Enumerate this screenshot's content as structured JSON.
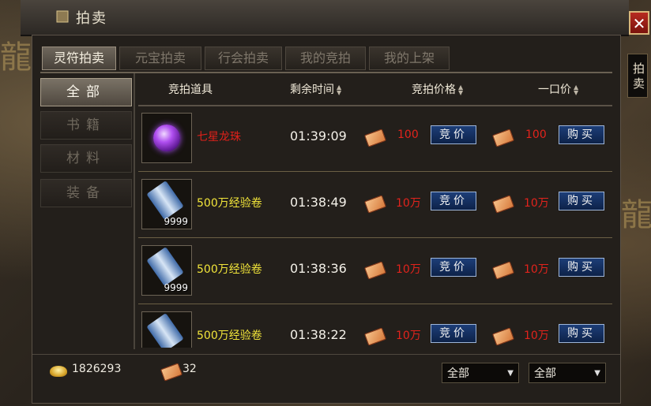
{
  "window": {
    "title": "拍卖",
    "side_tab": "拍卖"
  },
  "tabs": [
    {
      "label": "灵符拍卖",
      "active": true
    },
    {
      "label": "元宝拍卖",
      "active": false
    },
    {
      "label": "行会拍卖",
      "active": false
    },
    {
      "label": "我的竞拍",
      "active": false
    },
    {
      "label": "我的上架",
      "active": false
    }
  ],
  "categories": [
    {
      "label": "全部",
      "active": true
    },
    {
      "label": "书籍",
      "active": false
    },
    {
      "label": "材料",
      "active": false
    },
    {
      "label": "装备",
      "active": false
    }
  ],
  "columns": {
    "item": "竞拍道具",
    "time": "剩余时间",
    "bid_price": "竞拍价格",
    "buyout": "一口价"
  },
  "buttons": {
    "bid": "竞价",
    "buy": "购买"
  },
  "rows": [
    {
      "name": "七星龙珠",
      "name_color": "red",
      "icon": "purple-orb-icon",
      "qty": "",
      "time": "01:39:09",
      "bid": "100",
      "buyout": "100"
    },
    {
      "name": "500万经验卷",
      "name_color": "gold",
      "icon": "scroll-icon",
      "qty": "9999",
      "time": "01:38:49",
      "bid": "10万",
      "buyout": "10万"
    },
    {
      "name": "500万经验卷",
      "name_color": "gold",
      "icon": "scroll-icon",
      "qty": "9999",
      "time": "01:38:36",
      "bid": "10万",
      "buyout": "10万"
    },
    {
      "name": "500万经验卷",
      "name_color": "gold",
      "icon": "scroll-icon",
      "qty": "",
      "time": "01:38:22",
      "bid": "10万",
      "buyout": "10万"
    }
  ],
  "footer": {
    "gold": "1826293",
    "talisman": "32",
    "filter1": "全部",
    "filter2": "全部"
  }
}
